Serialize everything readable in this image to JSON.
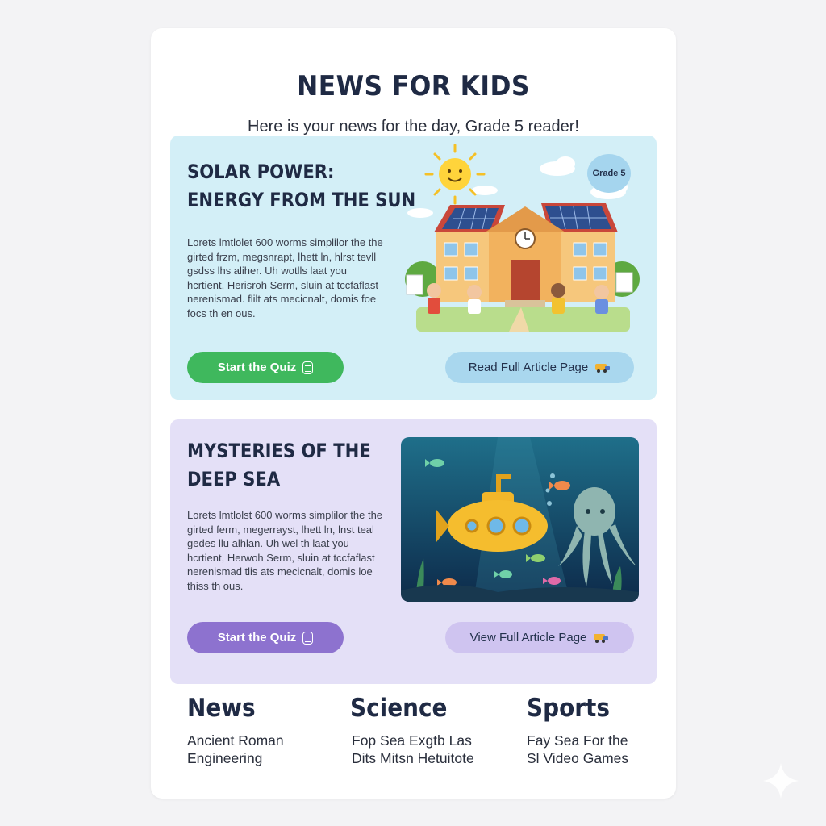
{
  "header": {
    "title": "NEWS FOR KIDS",
    "subtitle": "Here is your news for the day, Grade 5 reader!"
  },
  "articles": [
    {
      "headline_line1": "SOLAR POWER:",
      "headline_line2": "ENERGY FROM THE SUN",
      "body": "Lorets lmtlolet 600 worms simplilor the the girted frzm, megsnrapt, lhett ln, hlrst tevll gsdss lhs aliher. Uh wotlls laat you hcrtient, Herisroh Serm, sluin at tccfaflast nerenismad. flilt ats mecicnalt, domis foe focs th en ous.",
      "grade_badge": "Grade 5",
      "quiz_label": "Start the Quiz",
      "article_label": "Read Full Article Page",
      "icons": [
        "school-illustration",
        "sun-icon",
        "solar-panel-icon"
      ]
    },
    {
      "headline_line1": "MYSTERIES OF THE",
      "headline_line2": "DEEP SEA",
      "body": "Lorets lmtlolst 600 worms simplilor the the girted ferm, megerrayst, lhett ln, lnst teal gedes llu alhlan. Uh wel th laat you hcrtient, Herwoh Serm, sluin at tccfaflast nerenismad tlis ats mecicnalt, domis loe thiss th ous.",
      "quiz_label": "Start the Quiz",
      "article_label": "View Full Article Page",
      "icons": [
        "submarine-illustration",
        "octopus-icon",
        "fish-icon"
      ]
    }
  ],
  "categories": [
    {
      "name": "News",
      "line1": "Ancient Roman",
      "line2": "Engineering"
    },
    {
      "name": "Science",
      "line1": "Fop Sea Exgtb Las",
      "line2": "Dits Mitsn Hetuitote"
    },
    {
      "name": "Sports",
      "line1": "Fay Sea For the",
      "line2": "Sl Video Games"
    }
  ],
  "colors": {
    "card1_bg": "#d3eff7",
    "card2_bg": "#e4e0f7",
    "quiz_green": "#3fb85d",
    "quiz_purple": "#8d72cf",
    "heading": "#1f2a44"
  }
}
